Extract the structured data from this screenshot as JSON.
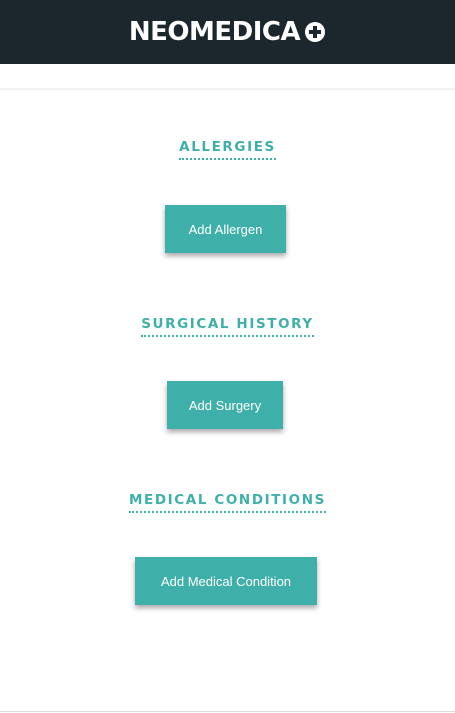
{
  "header": {
    "logo_text": "NEOMEDICA",
    "logo_icon": "plus-circle-icon"
  },
  "sections": [
    {
      "title": "ALLERGIES",
      "button_label": "Add Allergen"
    },
    {
      "title": "SURGICAL HISTORY",
      "button_label": "Add Surgery"
    },
    {
      "title": "MEDICAL CONDITIONS",
      "button_label": "Add Medical Condition"
    }
  ],
  "colors": {
    "header_bg": "#1b272d",
    "accent": "#3fb0a9",
    "button_text": "#ffffff"
  }
}
